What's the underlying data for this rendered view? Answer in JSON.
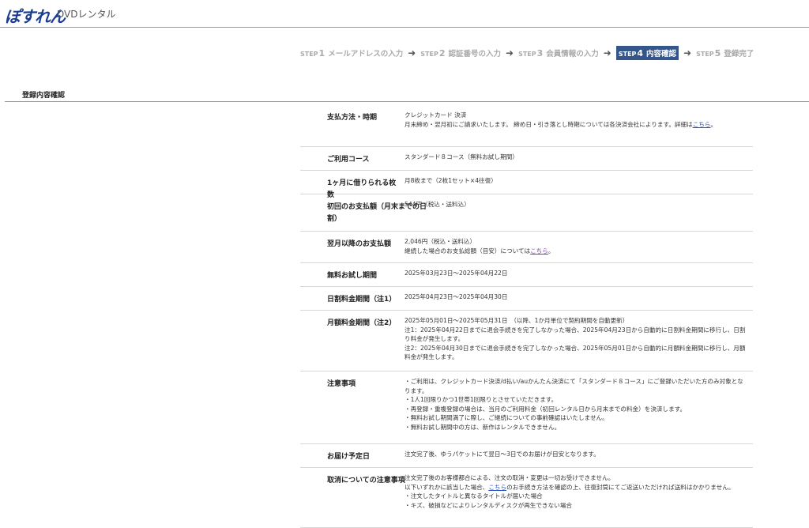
{
  "header": {
    "logo_text": "ぽすれん",
    "service_name": "DVDレンタル"
  },
  "steps": [
    {
      "word": "STEP",
      "num": "1",
      "label": "メールアドレスの入力",
      "active": false
    },
    {
      "word": "STEP",
      "num": "2",
      "label": "認証番号の入力",
      "active": false
    },
    {
      "word": "STEP",
      "num": "3",
      "label": "会員情報の入力",
      "active": false
    },
    {
      "word": "STEP",
      "num": "4",
      "label": "内容確認",
      "active": true
    },
    {
      "word": "STEP",
      "num": "5",
      "label": "登録完了",
      "active": false
    }
  ],
  "section_title": "登録内容確認",
  "rows": {
    "payment": {
      "label": "支払方法・時期",
      "line1": "クレジットカード 決済",
      "line2_pre": "月末締め・翌月初にご請求いたします。 締め日・引き落とし時期については各決済会社によります。詳細は",
      "link": "こちら",
      "line2_post": "。"
    },
    "course": {
      "label": "ご利用コース",
      "value": "スタンダード８コース（無料お試し期間）"
    },
    "discs": {
      "label": "1ヶ月に借りられる枚数",
      "value": "月8枚まで（2枚1セット×4往復）"
    },
    "first_payment": {
      "label": "初回のお支払額（月末までの日割）",
      "value": "544円（税込・送料込）"
    },
    "next_payment": {
      "label": "翌月以降のお支払額",
      "line1": "2,046円（税込・送料込）",
      "line2_pre": "継続した場合のお支払総額（目安）については",
      "link": "こちら",
      "line2_post": "。"
    },
    "trial": {
      "label": "無料お試し期間",
      "value": "2025年03月23日～2025年04月22日"
    },
    "daily": {
      "label": "日割料金期間（注1）",
      "value": "2025年04月23日～2025年04月30日"
    },
    "monthly": {
      "label": "月額料金期間（注2）",
      "line1": "2025年05月01日～2025年05月31日　（以降、1か月単位で契約期間を自動更新）",
      "line2": "注1：2025年04月22日までに退会手続きを完了しなかった場合、2025年04月23日から自動的に日割料金期間に移行し、日割り料金が発生します。",
      "line3": "注2：2025年04月30日までに退会手続きを完了しなかった場合、2025年05月01日から自動的に月額料金期間に移行し、月額料金が発生します。"
    },
    "notes": {
      "label": "注意事項",
      "items": [
        "・ご利用は、クレジットカード決済/d払い/auかんたん決済にて「スタンダード８コース」にご登録いただいた方のみ対象となります。",
        "・1人1回限りかつ1世帯1回限りとさせていただきます。",
        "・再登録・重複登録の場合は、当月のご利用料金（初回レンタル日から月末までの料金）を決済します。",
        "・無料お試し期間満了に際し、ご継続についての事前確認はいたしません。",
        "・無料お試し期間中の方は、新作はレンタルできません。"
      ]
    },
    "delivery": {
      "label": "お届け予定日",
      "value": "注文完了後、ゆうパケットにて翌日～3日でのお届けが目安となります。"
    },
    "cancel": {
      "label": "取消についての注意事項",
      "line1": "注文完了後のお客様都合による、注文の取消・変更は一切お受けできません。",
      "line2_pre": "以下いずれかに該当した場合、",
      "link": "こちら",
      "line2_post": "のお手続き方法を確認の上、往復封筒にてご返送いただければ送料はかかりません。",
      "items": [
        "・注文したタイトルと異なるタイトルが届いた場合",
        "・キズ、破損などによりレンタルディスクが再生できない場合"
      ]
    }
  },
  "colors": {
    "brand": "#1b3d8f",
    "step_active_bg": "#34568b",
    "link": "#2a52be",
    "link_visited": "#7b3fa0"
  }
}
